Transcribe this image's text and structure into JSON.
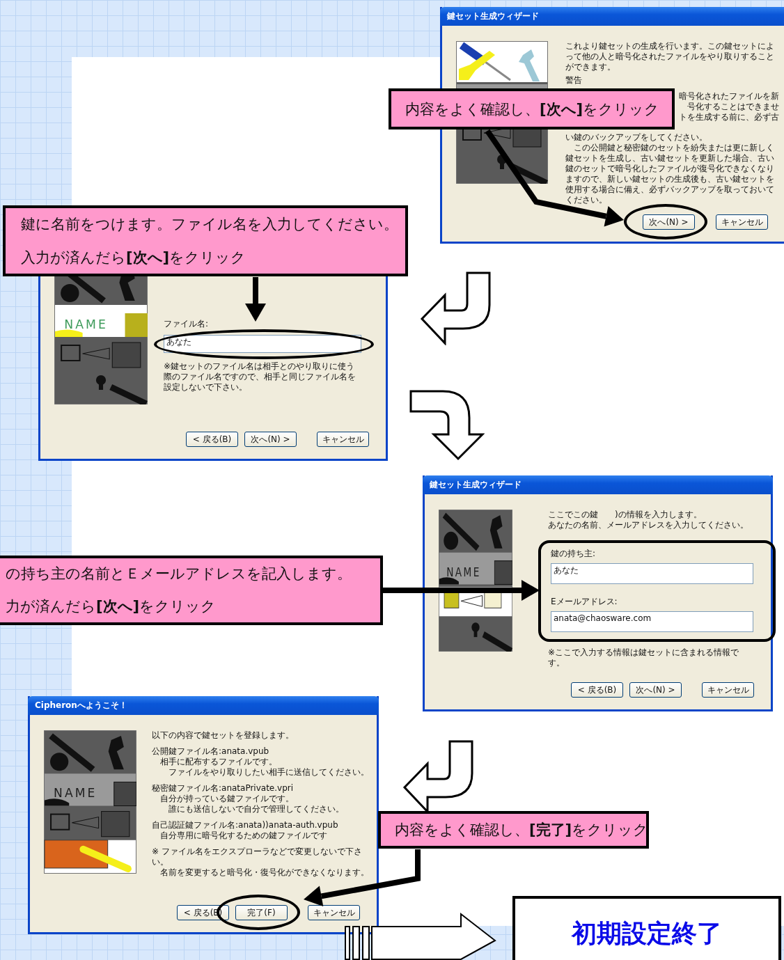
{
  "step_intro": {
    "dialog": {
      "title": "鍵セット生成ウィザード",
      "illustration": {
        "kind": "tools"
      },
      "intro_lines": [
        "これより鍵セットの生成を行います。この鍵セットによって他の人と暗号化されたファイルをやり取りすることができます。"
      ],
      "warning_heading": "警告",
      "warning_lines": [
        {
          "kind": "cut",
          "text": "暗号化されたファイルを新"
        },
        {
          "kind": "cut",
          "text": "号化することはできませ"
        },
        {
          "kind": "cut",
          "text": "トを生成する前に、必ず古"
        },
        {
          "kind": "full",
          "text": "い鍵のバックアップをしてください。"
        },
        {
          "kind": "full",
          "text": "　この公開鍵と秘密鍵のセットを紛失または更に新しく鍵セットを生成し、古い鍵セットを更新した場合、古い鍵のセットで暗号化したファイルが復号化できなくなりますので、新しい鍵セットの生成後も、古い鍵セットを使用する場合に備え、必ずバックアップを取っておいてください。"
        }
      ],
      "buttons": [
        {
          "label": "次へ(N) >",
          "circled": true
        },
        {
          "label": "キャンセル",
          "circled": false
        }
      ]
    },
    "callout": {
      "lines": [
        "内容をよく確認し、**[次へ]**をクリック"
      ]
    }
  },
  "step_filename": {
    "callout": {
      "lines": [
        "鍵に名前をつけます。ファイル名を入力してください。",
        "入力が済んだら**[次へ]**をクリック"
      ]
    },
    "dialog": {
      "illustration": {
        "kind": "name",
        "name_label": "NAME"
      },
      "field": {
        "label": "ファイル名:",
        "value": "あなた",
        "circled": true
      },
      "note_lines": [
        "※鍵セットのファイル名は相手とのやり取りに使う際のファイル名ですので、相手と同じファイル名を設定しないで下さい。"
      ],
      "buttons": [
        {
          "label": "< 戻る(B)",
          "circled": false
        },
        {
          "label": "次へ(N) >",
          "circled": false
        },
        {
          "label": "キャンセル",
          "circled": false
        }
      ]
    }
  },
  "step_owner": {
    "dialog": {
      "title": "鍵セット生成ウィザード",
      "illustration": {
        "kind": "mail",
        "name_label": "NAME"
      },
      "intro_lines": [
        "ここでこの鍵　　)の情報を入力します。",
        "あなたの名前、メールアドレスを入力してください。"
      ],
      "fields_highlighted": true,
      "fields": [
        {
          "label": "鍵の持ち主:",
          "value": "あなた"
        },
        {
          "label": "Eメールアドレス:",
          "value": "anata@chaosware.com"
        }
      ],
      "note": "※ここで入力する情報は鍵セットに含まれる情報です。",
      "buttons": [
        {
          "label": "< 戻る(B)",
          "circled": false
        },
        {
          "label": "次へ(N) >",
          "circled": false
        },
        {
          "label": "キャンセル",
          "circled": false
        }
      ]
    },
    "callout": {
      "lines": [
        "の持ち主の名前とＥメールアドレスを記入します。",
        "力が済んだら**[次へ]**をクリック"
      ]
    }
  },
  "step_confirm": {
    "dialog": {
      "title": "Cipheronへようこそ！",
      "illustration": {
        "kind": "key",
        "name_label": "NAME"
      },
      "paragraphs": [
        {
          "lines": [
            "以下の内容で鍵セットを登録します。"
          ]
        },
        {
          "lines": [
            "公開鍵ファイル名:anata.vpub",
            "　相手に配布するファイルです。",
            "　　ファイルをやり取りしたい相手に送信してください。"
          ]
        },
        {
          "lines": [
            "秘密鍵ファイル名:anataPrivate.vpri",
            "　自分が持っている鍵ファイルです。",
            "　　誰にも送信しないで自分で管理してください。"
          ]
        },
        {
          "lines": [
            "自己認証鍵ファイル名:anata))anata-auth.vpub",
            "　自分専用に暗号化するための鍵ファイルです"
          ]
        },
        {
          "lines": [
            "※ ファイル名をエクスプローラなどで変更しないで下さい。",
            "　名前を変更すると暗号化・復号化ができなくなります。"
          ]
        }
      ],
      "buttons": [
        {
          "label": "< 戻る(B)",
          "circled": false
        },
        {
          "label": "完了(F)",
          "circled": true
        },
        {
          "label": "キャンセル",
          "circled": false
        }
      ]
    },
    "callout": {
      "lines": [
        "内容をよく確認し、**[完了]**をクリック"
      ]
    }
  },
  "final_box": {
    "text": "初期設定終了"
  }
}
